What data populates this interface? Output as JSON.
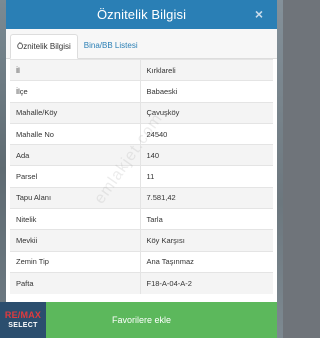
{
  "dialog": {
    "title": "Öznitelik Bilgisi",
    "close_label": "×"
  },
  "tabs": [
    {
      "label": "Öznitelik Bilgisi",
      "active": true
    },
    {
      "label": "Bina/BB Listesi",
      "active": false
    }
  ],
  "attributes": [
    {
      "key": "İl",
      "value": "Kırklareli"
    },
    {
      "key": "İlçe",
      "value": "Babaeski"
    },
    {
      "key": "Mahalle/Köy",
      "value": "Çavuşköy"
    },
    {
      "key": "Mahalle No",
      "value": "24540"
    },
    {
      "key": "Ada",
      "value": "140"
    },
    {
      "key": "Parsel",
      "value": "11"
    },
    {
      "key": "Tapu Alanı",
      "value": "7.581,42"
    },
    {
      "key": "Nitelik",
      "value": "Tarla"
    },
    {
      "key": "Mevkii",
      "value": "Köy Karşısı"
    },
    {
      "key": "Zemin Tip",
      "value": "Ana Taşınmaz"
    },
    {
      "key": "Pafta",
      "value": "F18-A-04-A-2"
    }
  ],
  "footer": {
    "button_label": "Favorilere ekle"
  },
  "watermark": "emlakjet.com",
  "logo": {
    "top": "RE/MAX",
    "bottom": "SELECT"
  },
  "colors": {
    "header": "#2a7fb5",
    "footer": "#5cb85c",
    "logo_bg": "#2b4e6e",
    "logo_red": "#e03a3e"
  }
}
